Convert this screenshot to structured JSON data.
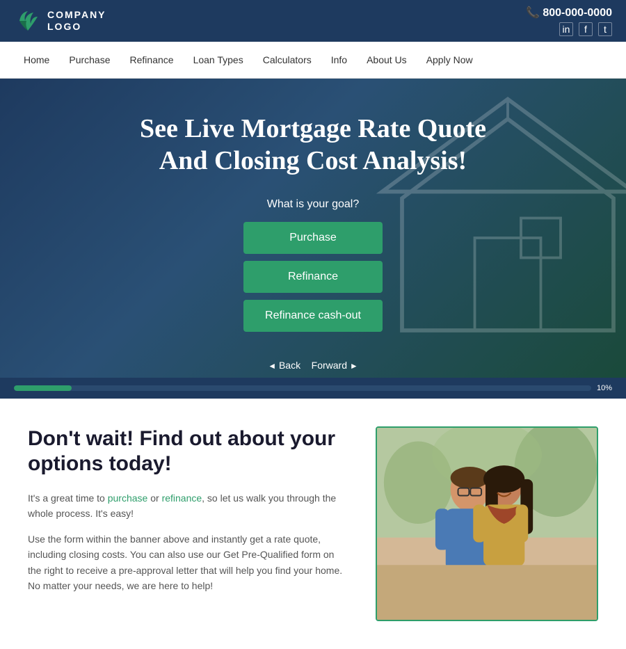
{
  "topbar": {
    "phone": "800-000-0000",
    "social": [
      "in",
      "f",
      "t"
    ]
  },
  "logo": {
    "line1": "COMPANY",
    "line2": "LOGO"
  },
  "nav": {
    "items": [
      {
        "label": "Home",
        "href": "#"
      },
      {
        "label": "Purchase",
        "href": "#"
      },
      {
        "label": "Refinance",
        "href": "#"
      },
      {
        "label": "Loan Types",
        "href": "#"
      },
      {
        "label": "Calculators",
        "href": "#"
      },
      {
        "label": "Info",
        "href": "#"
      },
      {
        "label": "About Us",
        "href": "#"
      },
      {
        "label": "Apply Now",
        "href": "#"
      }
    ]
  },
  "hero": {
    "title_line1": "See Live Mortgage Rate Quote",
    "title_line2": "And Closing Cost Analysis!",
    "question": "What is your goal?",
    "buttons": [
      {
        "label": "Purchase",
        "id": "purchase"
      },
      {
        "label": "Refinance",
        "id": "refinance"
      },
      {
        "label": "Refinance cash-out",
        "id": "refinance-cashout"
      }
    ],
    "back_label": "Back",
    "forward_label": "Forward"
  },
  "progress": {
    "percent": 10,
    "label": "10%"
  },
  "lower": {
    "heading": "Don't wait! Find out about your options today!",
    "paragraph1": "It's a great time to purchase or refinance, so let us walk you through the whole process. It's easy!",
    "paragraph1_purchase": "purchase",
    "paragraph1_refinance": "refinance",
    "paragraph2": "Use the form within the banner above and instantly get a rate quote, including closing costs. You can also use our Get Pre-Qualified form on the right to receive a pre-approval letter that will help you find your home. No matter your needs, we are here to help!"
  }
}
